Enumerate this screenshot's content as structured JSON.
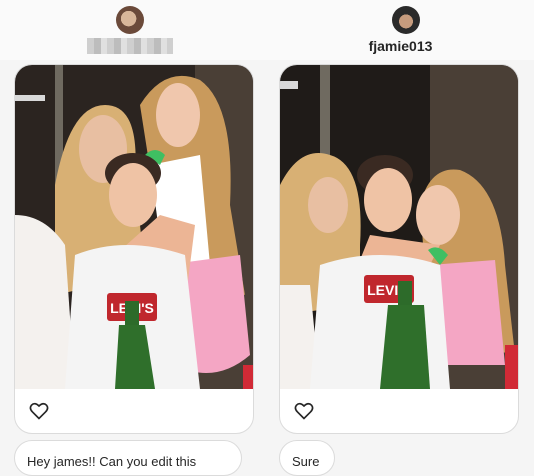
{
  "left": {
    "username_redacted": true,
    "message": "Hey james!! Can you edit this"
  },
  "right": {
    "username": "fjamie013",
    "message": "Sure"
  },
  "icons": {
    "like": "heart-icon"
  }
}
